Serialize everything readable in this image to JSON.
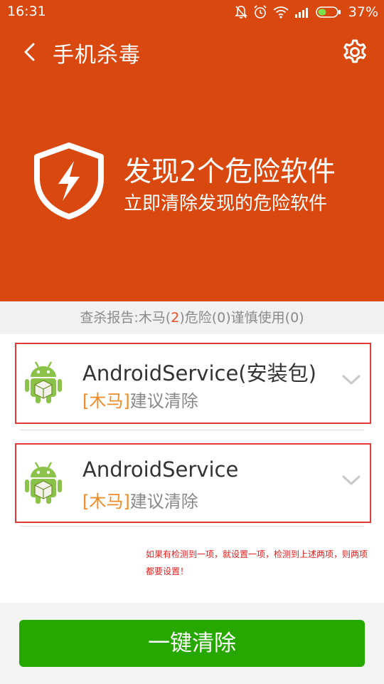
{
  "status_bar": {
    "time": "16:31",
    "battery": "37%"
  },
  "header": {
    "title": "手机杀毒"
  },
  "summary": {
    "headline": "发现2个危险软件",
    "subline": "立即清除发现的危险软件"
  },
  "report": {
    "prefix": "查杀报告:木马(",
    "trojan_count": "2",
    "middle": ")危险(",
    "danger_count": "0",
    "suffix": ")谨慎使用(0)"
  },
  "threats": [
    {
      "name": "AndroidService(安装包)",
      "tag": "[木马]",
      "advice": "建议清除"
    },
    {
      "name": "AndroidService",
      "tag": "[木马]",
      "advice": "建议清除"
    }
  ],
  "note": "如果有检测到一项，就设置一项，检测到上述两项，则两项都要设置！",
  "actions": {
    "clean_label": "一键清除"
  },
  "colors": {
    "hero": "#d9480f",
    "danger_border": "#e53935",
    "tag": "#f08a24",
    "button": "#26a800"
  }
}
